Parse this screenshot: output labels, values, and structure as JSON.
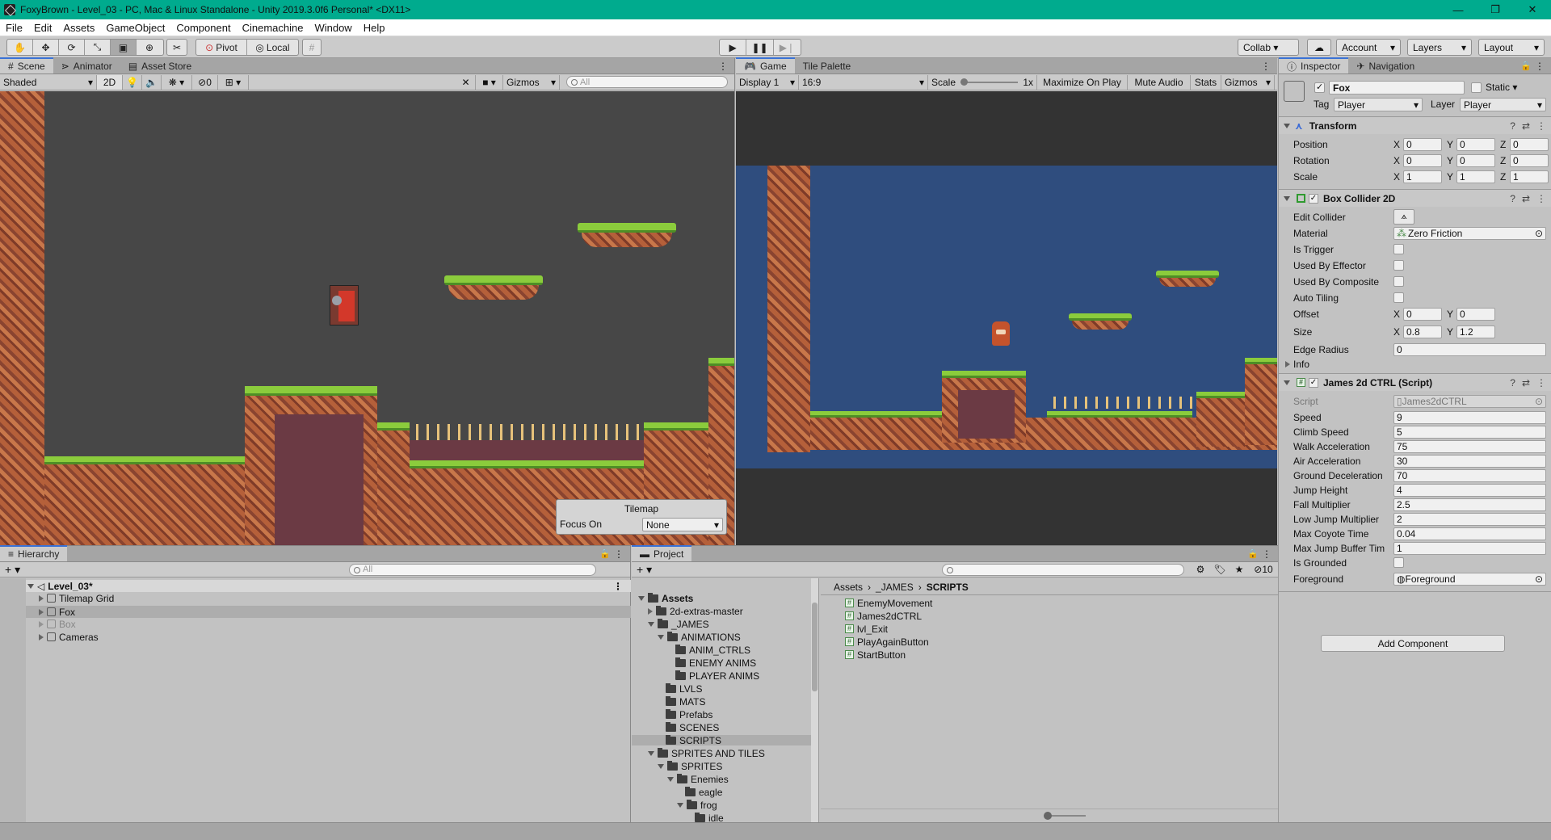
{
  "window": {
    "title": "FoxyBrown - Level_03 - PC, Mac & Linux Standalone - Unity 2019.3.0f6 Personal* <DX11>",
    "minimize": "—",
    "maximize": "❐",
    "close": "✕"
  },
  "menu": [
    "File",
    "Edit",
    "Assets",
    "GameObject",
    "Component",
    "Cinemachine",
    "Window",
    "Help"
  ],
  "toolbar": {
    "pivot": "Pivot",
    "local": "Local",
    "collab": "Collab ▾",
    "account": "Account",
    "layers": "Layers",
    "layout": "Layout"
  },
  "scene_panel": {
    "tabs": [
      "Scene",
      "Animator",
      "Asset Store"
    ],
    "shading": "Shaded",
    "mode_2d": "2D",
    "hidden_count": "0",
    "gizmos": "Gizmos",
    "search_placeholder": "All",
    "tilemap_overlay": {
      "title": "Tilemap",
      "focus_label": "Focus On",
      "focus_value": "None"
    }
  },
  "game_panel": {
    "tabs": [
      "Game",
      "Tile Palette"
    ],
    "display": "Display 1",
    "aspect": "16:9",
    "scale_label": "Scale",
    "scale_value": "1x",
    "maximize": "Maximize On Play",
    "mute": "Mute Audio",
    "stats": "Stats",
    "gizmos": "Gizmos"
  },
  "hierarchy": {
    "tab": "Hierarchy",
    "search_placeholder": "All",
    "scene": "Level_03*",
    "items": [
      {
        "label": "Tilemap Grid",
        "selected": false,
        "disabled": false
      },
      {
        "label": "Fox",
        "selected": true,
        "disabled": false
      },
      {
        "label": "Box",
        "selected": false,
        "disabled": true
      },
      {
        "label": "Cameras",
        "selected": false,
        "disabled": false
      }
    ]
  },
  "project": {
    "tab": "Project",
    "hidden_count": "10",
    "tree": [
      {
        "label": "Assets",
        "depth": 0,
        "bold": true,
        "expanded": true
      },
      {
        "label": "2d-extras-master",
        "depth": 1,
        "expanded": false
      },
      {
        "label": "_JAMES",
        "depth": 1,
        "expanded": true
      },
      {
        "label": "ANIMATIONS",
        "depth": 2,
        "expanded": true
      },
      {
        "label": "ANIM_CTRLS",
        "depth": 3
      },
      {
        "label": "ENEMY ANIMS",
        "depth": 3
      },
      {
        "label": "PLAYER ANIMS",
        "depth": 3
      },
      {
        "label": "LVLS",
        "depth": 2
      },
      {
        "label": "MATS",
        "depth": 2
      },
      {
        "label": "Prefabs",
        "depth": 2
      },
      {
        "label": "SCENES",
        "depth": 2
      },
      {
        "label": "SCRIPTS",
        "depth": 2,
        "selected": true
      },
      {
        "label": "SPRITES AND TILES",
        "depth": 1,
        "expanded": true
      },
      {
        "label": "SPRITES",
        "depth": 2,
        "expanded": true
      },
      {
        "label": "Enemies",
        "depth": 3,
        "expanded": true
      },
      {
        "label": "eagle",
        "depth": 4
      },
      {
        "label": "frog",
        "depth": 4,
        "expanded": true
      },
      {
        "label": "idle",
        "depth": 5
      }
    ],
    "breadcrumb": [
      "Assets",
      "_JAMES",
      "SCRIPTS"
    ],
    "files": [
      "EnemyMovement",
      "James2dCTRL",
      "lvl_Exit",
      "PlayAgainButton",
      "StartButton"
    ]
  },
  "inspector": {
    "tabs": [
      "Inspector",
      "Navigation"
    ],
    "object_name": "Fox",
    "static_label": "Static",
    "tag_label": "Tag",
    "tag_value": "Player",
    "layer_label": "Layer",
    "layer_value": "Player",
    "transform": {
      "title": "Transform",
      "position": {
        "label": "Position",
        "x": "0",
        "y": "0",
        "z": "0"
      },
      "rotation": {
        "label": "Rotation",
        "x": "0",
        "y": "0",
        "z": "0"
      },
      "scale": {
        "label": "Scale",
        "x": "1",
        "y": "1",
        "z": "1"
      }
    },
    "box_collider": {
      "title": "Box Collider 2D",
      "edit_collider": "Edit Collider",
      "material_label": "Material",
      "material_value": "Zero Friction",
      "is_trigger": "Is Trigger",
      "used_by_effector": "Used By Effector",
      "used_by_composite": "Used By Composite",
      "auto_tiling": "Auto Tiling",
      "offset": {
        "label": "Offset",
        "x": "0",
        "y": "0"
      },
      "size": {
        "label": "Size",
        "x": "0.8",
        "y": "1.2"
      },
      "edge_radius": {
        "label": "Edge Radius",
        "value": "0"
      },
      "info": "Info"
    },
    "script_component": {
      "title": "James 2d CTRL (Script)",
      "script_label": "Script",
      "script_value": "James2dCTRL",
      "fields": [
        {
          "label": "Speed",
          "value": "9"
        },
        {
          "label": "Climb Speed",
          "value": "5"
        },
        {
          "label": "Walk Acceleration",
          "value": "75"
        },
        {
          "label": "Air Acceleration",
          "value": "30"
        },
        {
          "label": "Ground Deceleration",
          "value": "70"
        },
        {
          "label": "Jump Height",
          "value": "4"
        },
        {
          "label": "Fall Multiplier",
          "value": "2.5"
        },
        {
          "label": "Low Jump Multiplier",
          "value": "2"
        },
        {
          "label": "Max Coyote Time",
          "value": "0.04"
        },
        {
          "label": "Max Jump Buffer Tim",
          "value": "1"
        }
      ],
      "is_grounded": "Is Grounded",
      "foreground_label": "Foreground",
      "foreground_value": "Foreground"
    },
    "add_component": "Add Component"
  },
  "colors": {
    "accent": "#00ab8e",
    "selection": "#3a72d6",
    "game_sky": "#2f4d7e",
    "scene_bg": "#474747"
  }
}
